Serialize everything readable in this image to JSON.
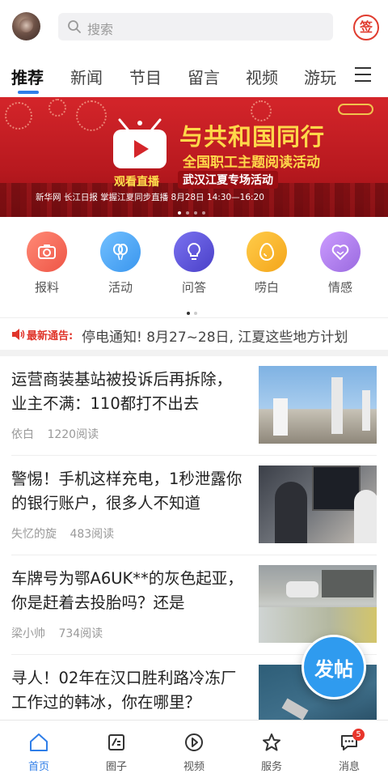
{
  "header": {
    "search_placeholder": "搜索",
    "sign_label": "签"
  },
  "tabs": [
    {
      "label": "推荐",
      "active": true
    },
    {
      "label": "新闻"
    },
    {
      "label": "节目"
    },
    {
      "label": "留言"
    },
    {
      "label": "视频"
    },
    {
      "label": "游玩"
    }
  ],
  "banner": {
    "title": "与共和国同行",
    "subtitle": "全国职工主题阅读活动",
    "subtitle2": "武汉江夏专场活动",
    "watch_label": "观看直播",
    "info_line": "新华网 长江日报 掌握江夏同步直播  8月28日 14:30—16:20"
  },
  "quick_actions": [
    {
      "label": "报料",
      "icon": "camera-icon",
      "color": "#f2685a"
    },
    {
      "label": "活动",
      "icon": "balloon-icon",
      "color": "#4ea8f3"
    },
    {
      "label": "问答",
      "icon": "lightbulb-icon",
      "color": "#5a52d6"
    },
    {
      "label": "唠白",
      "icon": "egg-icon",
      "color": "#f8b62b"
    },
    {
      "label": "情感",
      "icon": "heart-icon",
      "color": "#b27ee8"
    }
  ],
  "notice": {
    "tag": "最新通告:",
    "text": "停电通知! 8月27~28日, 江夏这些地方计划"
  },
  "feed": [
    {
      "title": "运营商装基站被投诉后再拆除，业主不满：110都打不出去",
      "author": "依白",
      "reads": "1220阅读"
    },
    {
      "title": "警惕！手机这样充电，1秒泄露你的银行账户，很多人不知道",
      "author": "失忆的旋",
      "reads": "483阅读"
    },
    {
      "title": "车牌号为鄂A6UK**的灰色起亚，你是赶着去投胎吗？还是",
      "author": "梁小帅",
      "reads": "734阅读"
    },
    {
      "title": "寻人！02年在汉口胜利路冷冻厂工作过的韩冰，你在哪里？",
      "author": "",
      "reads": ""
    }
  ],
  "fab_label": "发帖",
  "bottom_nav": [
    {
      "label": "首页",
      "icon": "home-icon",
      "active": true
    },
    {
      "label": "圈子",
      "icon": "edit-icon"
    },
    {
      "label": "视频",
      "icon": "play-icon"
    },
    {
      "label": "服务",
      "icon": "star-icon"
    },
    {
      "label": "消息",
      "icon": "message-icon",
      "badge": "5"
    }
  ],
  "colors": {
    "accent": "#2f7ee8",
    "brand_red": "#e03c2f",
    "fab": "#2f9bef"
  }
}
